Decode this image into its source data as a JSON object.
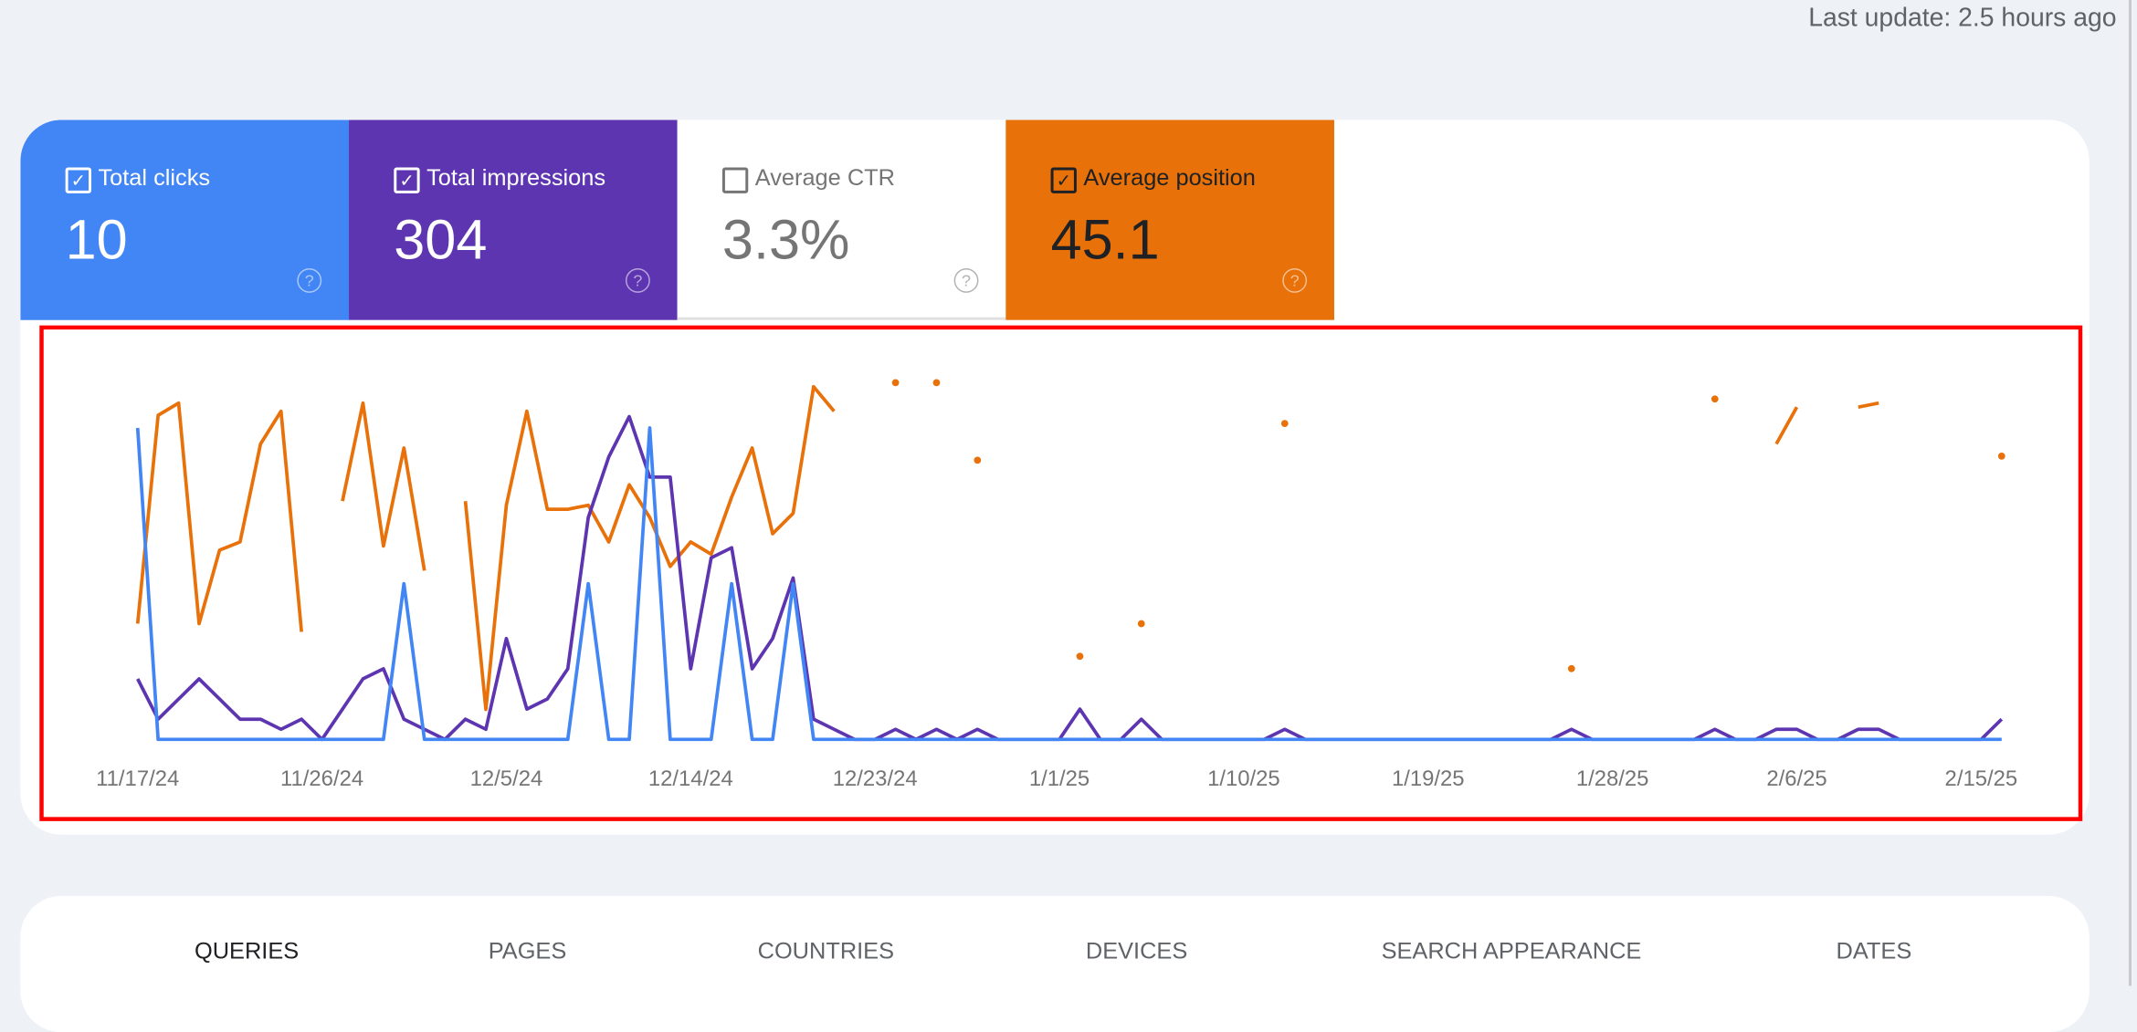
{
  "header": {
    "last_update": "Last update: 2.5 hours ago"
  },
  "metrics": [
    {
      "label": "Total clicks",
      "value": "10",
      "checked": true,
      "color": "#4285f4",
      "check_icon": "✓",
      "help_icon": "?"
    },
    {
      "label": "Total impressions",
      "value": "304",
      "checked": true,
      "color": "#5e35b1",
      "check_icon": "✓",
      "help_icon": "?"
    },
    {
      "label": "Average CTR",
      "value": "3.3%",
      "checked": false,
      "color": "#ffffff",
      "check_icon": "",
      "help_icon": "?"
    },
    {
      "label": "Average position",
      "value": "45.1",
      "checked": true,
      "color": "#e8710a",
      "check_icon": "✓",
      "help_icon": "?"
    }
  ],
  "chart_data": {
    "type": "line",
    "x_start": "11/17/24",
    "x_end": "2/16/25",
    "x_tick_labels": [
      "11/17/24",
      "11/26/24",
      "12/5/24",
      "12/14/24",
      "12/23/24",
      "1/1/25",
      "1/10/25",
      "1/19/25",
      "1/28/25",
      "2/6/25",
      "2/15/25"
    ],
    "grid": false,
    "series": [
      {
        "name": "Total clicks",
        "color": "#4285f4",
        "ylim": [
          0,
          2.3
        ],
        "values": [
          2,
          0,
          0,
          0,
          0,
          0,
          0,
          0,
          0,
          0,
          0,
          0,
          0,
          1,
          0,
          0,
          0,
          0,
          0,
          0,
          0,
          0,
          1,
          0,
          0,
          2,
          0,
          0,
          0,
          1,
          0,
          0,
          1,
          0,
          0,
          0,
          0,
          0,
          0,
          0,
          0,
          0,
          0,
          0,
          0,
          0,
          0,
          0,
          0,
          0,
          0,
          0,
          0,
          0,
          0,
          0,
          0,
          0,
          0,
          0,
          0,
          0,
          0,
          0,
          0,
          0,
          0,
          0,
          0,
          0,
          0,
          0,
          0,
          0,
          0,
          0,
          0,
          0,
          0,
          0,
          0,
          0,
          0,
          0,
          0,
          0,
          0,
          0,
          0,
          0,
          0,
          0
        ]
      },
      {
        "name": "Total impressions",
        "color": "#5e35b1",
        "ylim": [
          0,
          35.5
        ],
        "values": [
          6,
          2,
          4,
          6,
          4,
          2,
          2,
          1,
          2,
          0,
          3,
          6,
          7,
          2,
          1,
          0,
          2,
          1,
          10,
          3,
          4,
          7,
          22,
          28,
          32,
          26,
          26,
          7,
          18,
          19,
          7,
          10,
          16,
          2,
          1,
          0,
          0,
          1,
          0,
          1,
          0,
          1,
          0,
          0,
          0,
          0,
          3,
          0,
          0,
          2,
          0,
          0,
          0,
          0,
          0,
          0,
          1,
          0,
          0,
          0,
          0,
          0,
          0,
          0,
          0,
          0,
          0,
          0,
          0,
          0,
          1,
          0,
          0,
          0,
          0,
          0,
          0,
          1,
          0,
          0,
          1,
          1,
          0,
          0,
          1,
          1,
          0,
          0,
          0,
          0,
          0,
          2
        ]
      },
      {
        "name": "Average position",
        "color": "#e8710a",
        "reversed": true,
        "ylim": [
          1,
          100
        ],
        "values": [
          67,
          16,
          13,
          67,
          49,
          47,
          23,
          15,
          69,
          null,
          37,
          13,
          48,
          24,
          54,
          null,
          37,
          88,
          38,
          15,
          39,
          39,
          38,
          47,
          33,
          41,
          53,
          47,
          50,
          36,
          24,
          45,
          40,
          9,
          15,
          null,
          null,
          8,
          null,
          8,
          null,
          27,
          null,
          null,
          null,
          null,
          75,
          null,
          null,
          67,
          null,
          null,
          null,
          null,
          null,
          null,
          18,
          null,
          null,
          null,
          null,
          null,
          null,
          null,
          null,
          null,
          null,
          null,
          null,
          null,
          78,
          null,
          null,
          null,
          null,
          null,
          null,
          12,
          null,
          null,
          23,
          14,
          null,
          null,
          14,
          13,
          null,
          null,
          null,
          null,
          null,
          26
        ]
      }
    ]
  },
  "tabs": [
    "QUERIES",
    "PAGES",
    "COUNTRIES",
    "DEVICES",
    "SEARCH APPEARANCE",
    "DATES"
  ]
}
